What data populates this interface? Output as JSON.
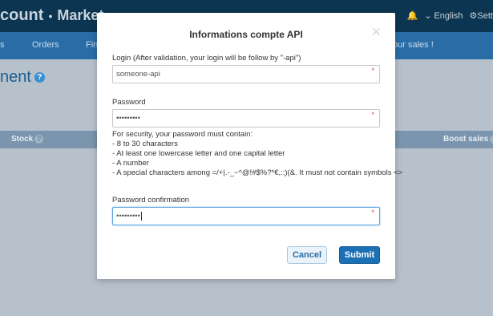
{
  "app": {
    "brand": "count",
    "brand_sub": "Market",
    "language": "English",
    "settings_label": "Sett"
  },
  "nav": {
    "items": [
      "s",
      "Orders",
      "Fin",
      "our sales !"
    ]
  },
  "page": {
    "heading": "nent"
  },
  "table": {
    "columns": [
      "Stock",
      "Boost sales"
    ]
  },
  "modal": {
    "title": "Informations compte API",
    "close": "×",
    "login": {
      "label": "Login (After validation, your login will be follow by \"-api\")",
      "value": "someone-api"
    },
    "password": {
      "label": "Password",
      "value": "•••••••••"
    },
    "rules": [
      "For security, your password must contain:",
      "- 8 to 30 characters",
      "- At least one lowercase letter and one capital letter",
      "- A number",
      "- A special characters among =/+|.-_~^@!#$%?*€,:;)(&. It must not contain symbols <>"
    ],
    "confirm": {
      "label": "Password confirmation",
      "value": "•••••••••"
    },
    "required_mark": "*",
    "cancel_label": "Cancel",
    "submit_label": "Submit"
  },
  "colors": {
    "topbar": "#0b3550",
    "navbar": "#2a6da6",
    "submit": "#1c70b5",
    "required": "#e2423b"
  }
}
